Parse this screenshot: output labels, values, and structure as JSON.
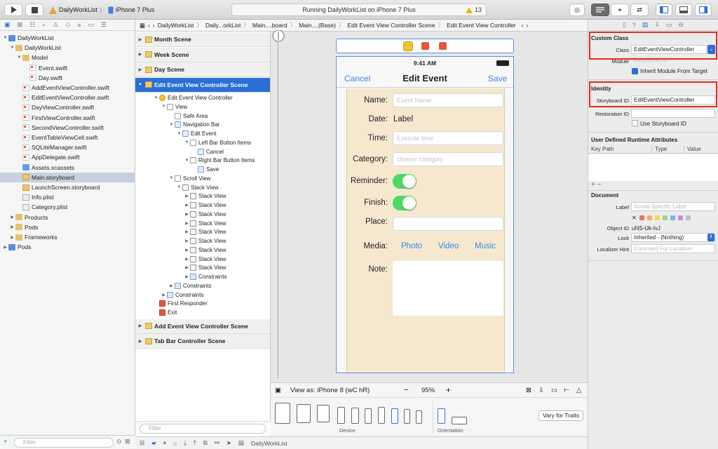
{
  "toolbar": {
    "scheme_app": "DailyWorkList",
    "scheme_device": "iPhone 7 Plus",
    "status": "Running DailyWorkList on iPhone 7 Plus",
    "warning_count": "13"
  },
  "navigator": {
    "items": [
      {
        "label": "DailyWorkList",
        "indent": 0,
        "disc": "▼",
        "icon": "proj"
      },
      {
        "label": "DailyWorkList",
        "indent": 1,
        "disc": "▼",
        "icon": "fold"
      },
      {
        "label": "Model",
        "indent": 2,
        "disc": "▼",
        "icon": "fold"
      },
      {
        "label": "Event.swift",
        "indent": 3,
        "disc": "",
        "icon": "sw"
      },
      {
        "label": "Day.swift",
        "indent": 3,
        "disc": "",
        "icon": "sw"
      },
      {
        "label": "AddEventViewController.swift",
        "indent": 2,
        "disc": "",
        "icon": "sw"
      },
      {
        "label": "EditEventViewController.swift",
        "indent": 2,
        "disc": "",
        "icon": "sw"
      },
      {
        "label": "DayViewController.swift",
        "indent": 2,
        "disc": "",
        "icon": "sw"
      },
      {
        "label": "FirstViewController.swift",
        "indent": 2,
        "disc": "",
        "icon": "sw"
      },
      {
        "label": "SecondViewController.swift",
        "indent": 2,
        "disc": "",
        "icon": "sw"
      },
      {
        "label": "EventTableViewCell.swift",
        "indent": 2,
        "disc": "",
        "icon": "sw"
      },
      {
        "label": "SQLiteManager.swift",
        "indent": 2,
        "disc": "",
        "icon": "sw"
      },
      {
        "label": "AppDelegate.swift",
        "indent": 2,
        "disc": "",
        "icon": "sw"
      },
      {
        "label": "Assets.xcassets",
        "indent": 2,
        "disc": "",
        "icon": "img"
      },
      {
        "label": "Main.storyboard",
        "indent": 2,
        "disc": "",
        "icon": "sb",
        "selected": true
      },
      {
        "label": "LaunchScreen.storyboard",
        "indent": 2,
        "disc": "",
        "icon": "sb"
      },
      {
        "label": "Info.plist",
        "indent": 2,
        "disc": "",
        "icon": "pl"
      },
      {
        "label": "Category.plist",
        "indent": 2,
        "disc": "",
        "icon": "pl"
      },
      {
        "label": "Products",
        "indent": 1,
        "disc": "▶",
        "icon": "fold"
      },
      {
        "label": "Pods",
        "indent": 1,
        "disc": "▶",
        "icon": "fold"
      },
      {
        "label": "Frameworks",
        "indent": 1,
        "disc": "▶",
        "icon": "fold"
      },
      {
        "label": "Pods",
        "indent": 0,
        "disc": "▶",
        "icon": "proj"
      }
    ],
    "filter_placeholder": "Filter"
  },
  "jumpbar": [
    "DailyWorkList",
    "Daily...orkList",
    "Main....board",
    "Main....(Base)",
    "Edit Event View Controller Scene",
    "Edit Event View Controller"
  ],
  "outline": {
    "scenes_top": [
      "Month Scene",
      "Week Scene",
      "Day Scene"
    ],
    "selected_scene": "Edit Event View Controller Scene",
    "rows": [
      {
        "label": "Edit Event View Controller",
        "indent": 1,
        "disc": "▼",
        "icon": "vc"
      },
      {
        "label": "View",
        "indent": 2,
        "disc": "▼",
        "icon": ""
      },
      {
        "label": "Safe Area",
        "indent": 3,
        "disc": "",
        "icon": ""
      },
      {
        "label": "Navigation Bar",
        "indent": 3,
        "disc": "▼",
        "icon": "nav"
      },
      {
        "label": "Edit Event",
        "indent": 4,
        "disc": "▼",
        "icon": "nav"
      },
      {
        "label": "Left Bar Button Items",
        "indent": 5,
        "disc": "▼",
        "icon": ""
      },
      {
        "label": "Cancel",
        "indent": 6,
        "disc": "",
        "icon": "nav"
      },
      {
        "label": "Right Bar Button Items",
        "indent": 5,
        "disc": "▼",
        "icon": ""
      },
      {
        "label": "Save",
        "indent": 6,
        "disc": "",
        "icon": "nav"
      },
      {
        "label": "Scroll View",
        "indent": 3,
        "disc": "▼",
        "icon": ""
      },
      {
        "label": "Stack View",
        "indent": 4,
        "disc": "▼",
        "icon": "stack"
      },
      {
        "label": "Stack View",
        "indent": 5,
        "disc": "▶",
        "icon": "stack"
      },
      {
        "label": "Stack View",
        "indent": 5,
        "disc": "▶",
        "icon": "stack"
      },
      {
        "label": "Stack View",
        "indent": 5,
        "disc": "▶",
        "icon": "stack"
      },
      {
        "label": "Stack View",
        "indent": 5,
        "disc": "▶",
        "icon": "stack"
      },
      {
        "label": "Stack View",
        "indent": 5,
        "disc": "▶",
        "icon": "stack"
      },
      {
        "label": "Stack View",
        "indent": 5,
        "disc": "▶",
        "icon": "stack"
      },
      {
        "label": "Stack View",
        "indent": 5,
        "disc": "▶",
        "icon": "stack"
      },
      {
        "label": "Stack View",
        "indent": 5,
        "disc": "▶",
        "icon": "stack"
      },
      {
        "label": "Stack View",
        "indent": 5,
        "disc": "▶",
        "icon": "stack"
      },
      {
        "label": "Constraints",
        "indent": 5,
        "disc": "▶",
        "icon": "cons"
      },
      {
        "label": "Constraints",
        "indent": 3,
        "disc": "▶",
        "icon": "cons"
      },
      {
        "label": "Constraints",
        "indent": 2,
        "disc": "▶",
        "icon": "cons"
      },
      {
        "label": "First Responder",
        "indent": 1,
        "disc": "",
        "icon": "red"
      },
      {
        "label": "Exit",
        "indent": 1,
        "disc": "",
        "icon": "red"
      }
    ],
    "scenes_bottom": [
      "Add Event View Controller Scene",
      "Tab Bar Controller Scene"
    ],
    "filter_placeholder": "Filter"
  },
  "phone": {
    "time": "9:41 AM",
    "nav_title": "Edit Event",
    "cancel": "Cancel",
    "save": "Save",
    "name_label": "Name:",
    "name_placeholder": "Event Name",
    "date_label": "Date:",
    "date_value": "Label",
    "time_label": "Time:",
    "time_placeholder": "Execute time",
    "category_label": "Category:",
    "category_placeholder": "choose category",
    "reminder_label": "Reminder:",
    "finish_label": "Finish:",
    "place_label": "Place:",
    "media_label": "Media:",
    "media_photo": "Photo",
    "media_video": "Video",
    "media_music": "Music",
    "note_label": "Note:"
  },
  "viewas": {
    "label": "View as: iPhone 8 (wC hR)",
    "zoom": "95%",
    "device_caption": "Device",
    "orientation_caption": "Orientation",
    "vary_button": "Vary for Traits"
  },
  "bottombar": {
    "target": "DailyWorkList"
  },
  "inspector": {
    "custom_class_title": "Custom Class",
    "class_label": "Class",
    "class_value": "EditEventViewController",
    "module_label": "Module",
    "module_placeholder": "DailyWorkList",
    "inherit_label": "Inherit Module From Target",
    "identity_title": "Identity",
    "storyboard_id_label": "Storyboard ID",
    "storyboard_id_value": "EditEventViewController",
    "restoration_id_label": "Restoration ID",
    "use_storyboard_id_label": "Use Storyboard ID",
    "udra_title": "User Defined Runtime Attributes",
    "col_keypath": "Key Path",
    "col_type": "Type",
    "col_value": "Value",
    "add_remove": "+ −",
    "document_title": "Document",
    "doc_label_label": "Label",
    "doc_label_placeholder": "Xcode Specific Label",
    "object_id_label": "Object ID",
    "object_id_value": "uNS-Uk-IvJ",
    "lock_label": "Lock",
    "lock_value": "Inherited - (Nothing)",
    "localizer_label": "Localizer Hint",
    "localizer_placeholder": "Comment For Localizer",
    "color_swatches": [
      "#e5736e",
      "#f0b35e",
      "#f0d95e",
      "#9fd67a",
      "#78b6ef",
      "#c78be0",
      "#c0c0c0"
    ]
  }
}
